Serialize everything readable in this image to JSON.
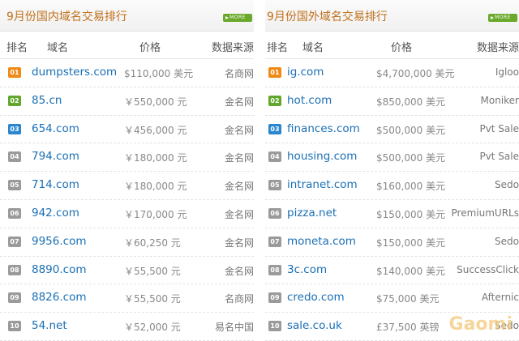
{
  "domestic": {
    "title": "9月份国内域名交易排行",
    "more": "MORE",
    "headers": {
      "rank": "排名",
      "domain": "域名",
      "price": "价格",
      "source": "数据来源"
    },
    "rows": [
      {
        "rank": "01",
        "domain": "dumpsters.com",
        "price": "$110,000 美元",
        "source": "名商网"
      },
      {
        "rank": "02",
        "domain": "85.cn",
        "price": "￥550,000 元",
        "source": "金名网"
      },
      {
        "rank": "03",
        "domain": "654.com",
        "price": "￥456,000 元",
        "source": "金名网"
      },
      {
        "rank": "04",
        "domain": "794.com",
        "price": "￥180,000 元",
        "source": "金名网"
      },
      {
        "rank": "05",
        "domain": "714.com",
        "price": "￥180,000 元",
        "source": "金名网"
      },
      {
        "rank": "06",
        "domain": "942.com",
        "price": "￥170,000 元",
        "source": "金名网"
      },
      {
        "rank": "07",
        "domain": "9956.com",
        "price": "￥60,250 元",
        "source": "金名网"
      },
      {
        "rank": "08",
        "domain": "8890.com",
        "price": "￥55,500 元",
        "source": "金名网"
      },
      {
        "rank": "09",
        "domain": "8826.com",
        "price": "￥55,500 元",
        "source": "名商网"
      },
      {
        "rank": "10",
        "domain": "54.net",
        "price": "￥52,000 元",
        "source": "易名中国"
      }
    ]
  },
  "foreign": {
    "title": "9月份国外域名交易排行",
    "more": "MORE",
    "headers": {
      "rank": "排名",
      "domain": "域名",
      "price": "价格",
      "source": "数据来源"
    },
    "rows": [
      {
        "rank": "01",
        "domain": "ig.com",
        "price": "$4,700,000 美元",
        "source": "Igloo"
      },
      {
        "rank": "02",
        "domain": "hot.com",
        "price": "$850,000 美元",
        "source": "Moniker"
      },
      {
        "rank": "03",
        "domain": "finances.com",
        "price": "$500,000 美元",
        "source": "Pvt Sale"
      },
      {
        "rank": "04",
        "domain": "housing.com",
        "price": "$500,000 美元",
        "source": "Pvt Sale"
      },
      {
        "rank": "05",
        "domain": "intranet.com",
        "price": "$160,000 美元",
        "source": "Sedo"
      },
      {
        "rank": "06",
        "domain": "pizza.net",
        "price": "$150,000 美元",
        "source": "PremiumURLs"
      },
      {
        "rank": "07",
        "domain": "moneta.com",
        "price": "$150,000 美元",
        "source": "Sedo"
      },
      {
        "rank": "08",
        "domain": "3c.com",
        "price": "$140,000 美元",
        "source": "SuccessClick"
      },
      {
        "rank": "09",
        "domain": "credo.com",
        "price": "$75,000 美元",
        "source": "Afternic"
      },
      {
        "rank": "10",
        "domain": "sale.co.uk",
        "price": "£37,500 英镑",
        "source": "Sedo"
      }
    ]
  },
  "watermark": "Gaomi"
}
